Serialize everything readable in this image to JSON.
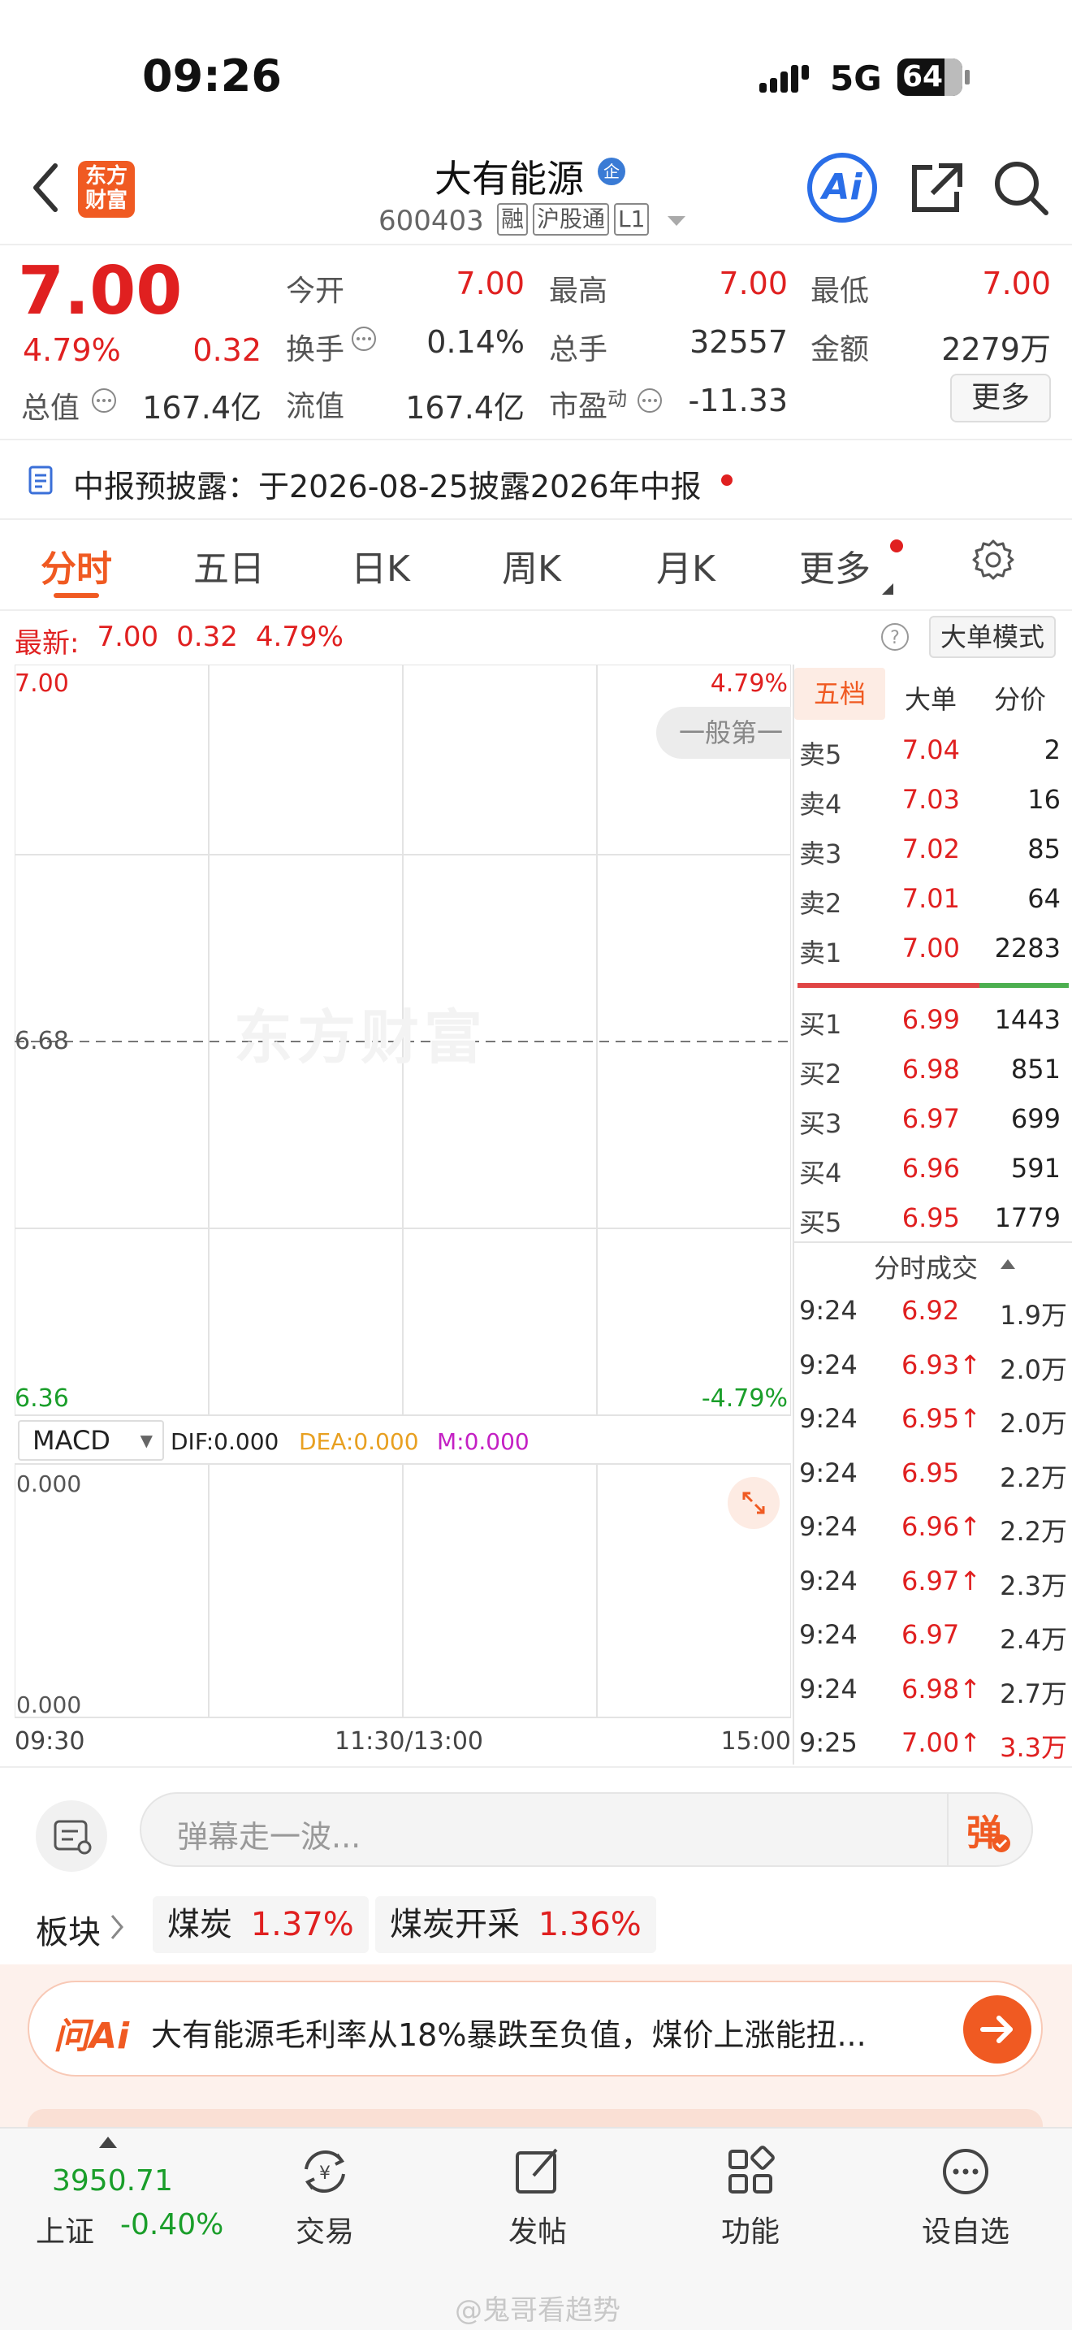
{
  "status": {
    "time": "09:26",
    "network": "5G",
    "battery": "64"
  },
  "header": {
    "logo_line1": "东方",
    "logo_line2": "财富",
    "stock_name": "大有能源",
    "badge_qi": "企",
    "stock_code": "600403",
    "tags": [
      "融",
      "沪股通",
      "L1"
    ],
    "ai_label": "Ai"
  },
  "quote": {
    "price": "7.00",
    "pct": "4.79%",
    "change": "0.32",
    "fields": {
      "open_label": "今开",
      "open": "7.00",
      "high_label": "最高",
      "high": "7.00",
      "low_label": "最低",
      "low": "7.00",
      "turnover_label": "换手",
      "turnover": "0.14%",
      "volume_label": "总手",
      "volume": "32557",
      "amount_label": "金额",
      "amount": "2279万",
      "mktcap_label": "总值",
      "mktcap": "167.4亿",
      "float_label": "流值",
      "float": "167.4亿",
      "pe_label": "市盈",
      "pe_sup": "动",
      "pe": "-11.33"
    },
    "more_button": "更多"
  },
  "notice": {
    "text": "中报预披露：于2026-08-25披露2026年中报"
  },
  "tabs": [
    "分时",
    "五日",
    "日K",
    "周K",
    "月K",
    "更多"
  ],
  "active_tab": "分时",
  "chart_info": {
    "latest_label": "最新:",
    "latest_price": "7.00",
    "latest_change": "0.32",
    "latest_pct": "4.79%",
    "mode_button": "大单模式"
  },
  "chart_data": {
    "type": "line",
    "title": "",
    "y_max": "7.00",
    "y_mid": "6.68",
    "y_min": "6.36",
    "pct_max": "4.79%",
    "pct_min": "-4.79%",
    "x_labels": [
      "09:30",
      "11:30/13:00",
      "15:00"
    ],
    "watermark": "东方财富",
    "overlay_label": "一般第一",
    "macd": {
      "indicator": "MACD",
      "dif": "DIF:0.000",
      "dea": "DEA:0.000",
      "m": "M:0.000",
      "top": "0.000",
      "bottom": "0.000"
    }
  },
  "orderbook": {
    "tabs": [
      "五档",
      "大单",
      "分价"
    ],
    "sells": [
      {
        "label": "卖5",
        "price": "7.04",
        "qty": "2"
      },
      {
        "label": "卖4",
        "price": "7.03",
        "qty": "16"
      },
      {
        "label": "卖3",
        "price": "7.02",
        "qty": "85"
      },
      {
        "label": "卖2",
        "price": "7.01",
        "qty": "64"
      },
      {
        "label": "卖1",
        "price": "7.00",
        "qty": "2283"
      }
    ],
    "buys": [
      {
        "label": "买1",
        "price": "6.99",
        "qty": "1443"
      },
      {
        "label": "买2",
        "price": "6.98",
        "qty": "851"
      },
      {
        "label": "买3",
        "price": "6.97",
        "qty": "699"
      },
      {
        "label": "买4",
        "price": "6.96",
        "qty": "591"
      },
      {
        "label": "买5",
        "price": "6.95",
        "qty": "1779"
      }
    ],
    "ticks_title": "分时成交",
    "ticks": [
      {
        "time": "9:24",
        "price": "6.92",
        "vol": "1.9万"
      },
      {
        "time": "9:24",
        "price": "6.93↑",
        "vol": "2.0万"
      },
      {
        "time": "9:24",
        "price": "6.95↑",
        "vol": "2.0万"
      },
      {
        "time": "9:24",
        "price": "6.95",
        "vol": "2.2万"
      },
      {
        "time": "9:24",
        "price": "6.96↑",
        "vol": "2.2万"
      },
      {
        "time": "9:24",
        "price": "6.97↑",
        "vol": "2.3万"
      },
      {
        "time": "9:24",
        "price": "6.97",
        "vol": "2.4万"
      },
      {
        "time": "9:24",
        "price": "6.98↑",
        "vol": "2.7万"
      },
      {
        "time": "9:25",
        "price": "7.00↑",
        "vol": "3.3万"
      }
    ]
  },
  "danmu": {
    "placeholder": "弹幕走一波...",
    "button": "弹"
  },
  "sectors": {
    "label": "板块",
    "items": [
      {
        "name": "煤炭",
        "pct": "1.37%"
      },
      {
        "name": "煤炭开采",
        "pct": "1.36%"
      }
    ]
  },
  "ai_bar": {
    "brand": "问Ai",
    "text": "大有能源毛利率从18%暴跌至负值，煤价上涨能扭..."
  },
  "bottom_bar": {
    "index_value": "3950.71",
    "index_name": "上证",
    "index_pct": "-0.40%",
    "items": [
      "交易",
      "发帖",
      "功能",
      "设自选"
    ]
  },
  "watermark_bottom": "@鬼哥看趋势"
}
